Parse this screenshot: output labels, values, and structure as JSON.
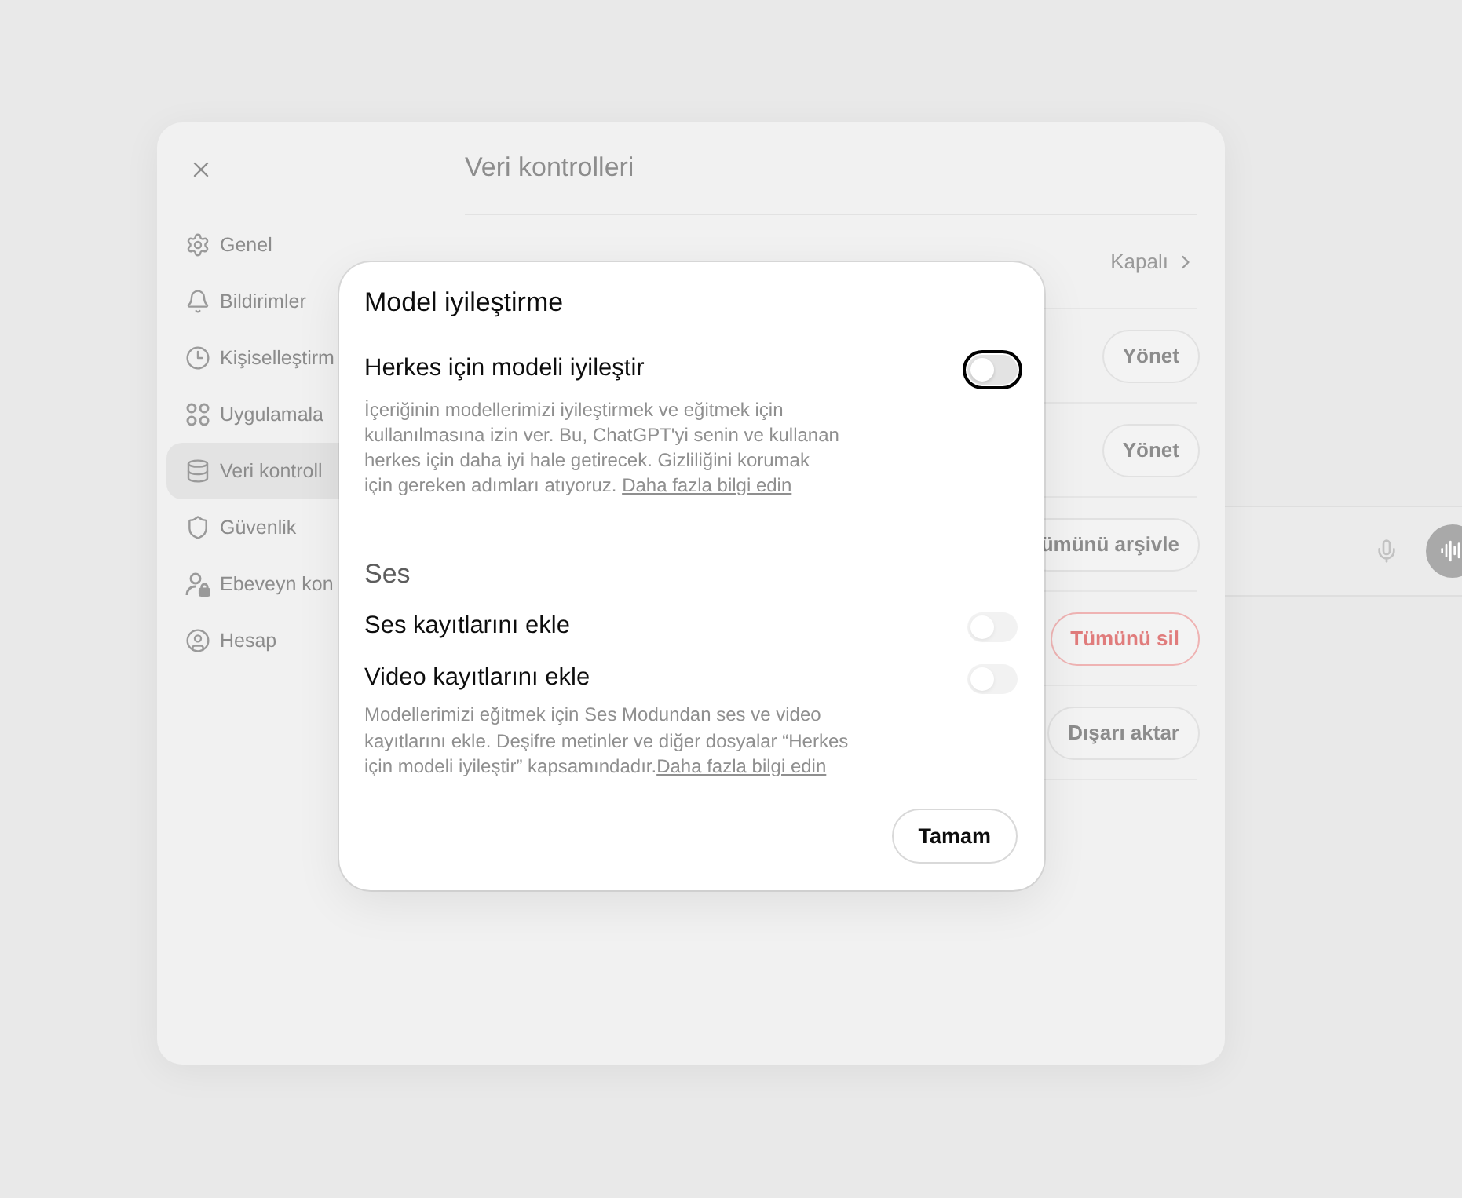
{
  "settings_window": {
    "title": "Veri kontrolleri",
    "sidebar": {
      "items": [
        {
          "label": "Genel",
          "selected": false
        },
        {
          "label": "Bildirimler",
          "selected": false
        },
        {
          "label": "Kişiselleştirm",
          "selected": false
        },
        {
          "label": "Uygulamala",
          "selected": false
        },
        {
          "label": "Veri kontroll",
          "selected": true
        },
        {
          "label": "Güvenlik",
          "selected": false
        },
        {
          "label": "Ebeveyn kon",
          "selected": false
        },
        {
          "label": "Hesap",
          "selected": false
        }
      ]
    },
    "rows": [
      {
        "kind": "value",
        "value": "Kapalı"
      },
      {
        "kind": "button",
        "button": "Yönet"
      },
      {
        "kind": "button",
        "button": "Yönet"
      },
      {
        "kind": "button",
        "button": "ümünü arşivle"
      },
      {
        "kind": "danger",
        "button": "Tümünü sil"
      },
      {
        "kind": "button",
        "button": "Dışarı aktar"
      }
    ]
  },
  "dialog": {
    "title": "Model iyileştirme",
    "groups": [
      {
        "settings": [
          {
            "kind": "focused",
            "label": "Herkes için modeli iyileştir",
            "on": false,
            "disabled": false
          }
        ],
        "description": "İçeriğinin modellerimizi iyileştirmek ve eğitmek için kullanılmasına izin ver. Bu, ChatGPT'yi senin ve kullanan herkes için daha iyi hale getirecek. Gizliliğini korumak için gereken adımları atıyoruz. ",
        "link": "Daha fazla bilgi edin"
      },
      {
        "heading": "Ses",
        "settings": [
          {
            "kind": "normal",
            "label": "Ses kayıtlarını ekle",
            "on": false,
            "disabled": true
          },
          {
            "kind": "normal",
            "label": "Video kayıtlarını ekle",
            "on": false,
            "disabled": true
          }
        ],
        "description": "Modellerimizi eğitmek için Ses Modundan ses ve video kayıtlarını ekle. Deşifre metinler ve diğer dosyalar “Herkes için modeli iyileştir” kapsamındadır.",
        "link": "Daha fazla bilgi edin"
      }
    ],
    "button": "Tamam"
  }
}
